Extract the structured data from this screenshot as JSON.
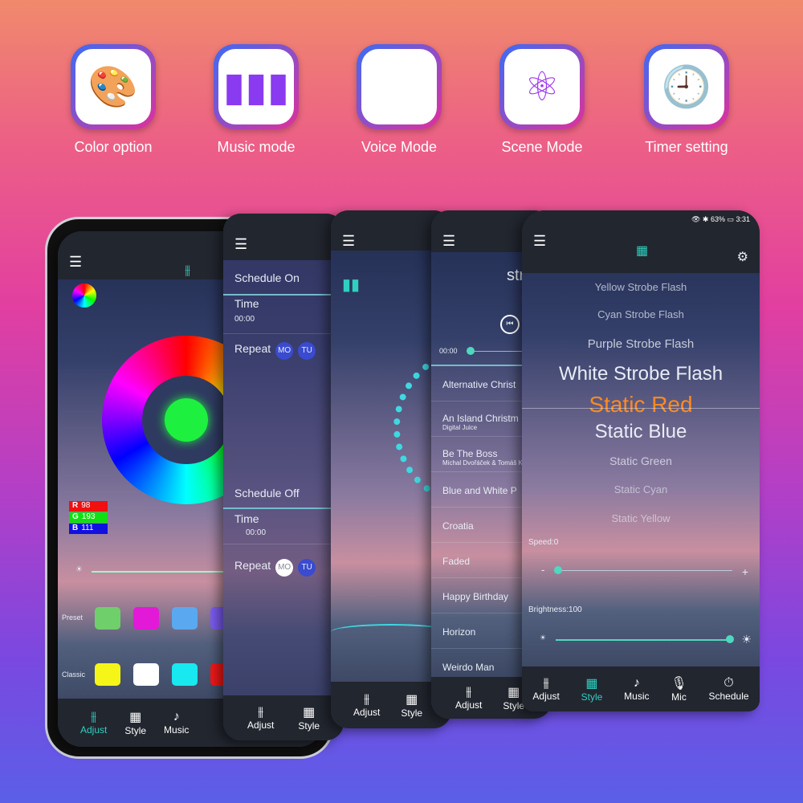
{
  "features": [
    {
      "label": "Color option",
      "icon": "palette-icon"
    },
    {
      "label": "Music mode",
      "icon": "soundwave-icon"
    },
    {
      "label": "Voice Mode",
      "icon": "microphone-icon"
    },
    {
      "label": "Scene Mode",
      "icon": "atom-icon"
    },
    {
      "label": "Timer setting",
      "icon": "clock-icon"
    }
  ],
  "status": {
    "battery": "63%",
    "time": "3:31"
  },
  "color_screen": {
    "rgb": {
      "r_label": "R",
      "r": "98",
      "g_label": "G",
      "g": "193",
      "b_label": "B",
      "b": "111"
    },
    "preset_label": "Preset",
    "classic_label": "Classic",
    "preset_colors": [
      "#6fcf6a",
      "#e21ad8",
      "#5aa8f0",
      "#7a5cf0"
    ],
    "classic_colors": [
      "#f5f518",
      "#ffffff",
      "#18e8f0",
      "#f01818"
    ]
  },
  "schedule_screen": {
    "on_label": "Schedule On",
    "time_label": "Time",
    "time_on": "00:00",
    "repeat_label": "Repeat",
    "days_on": [
      "MO",
      "TU"
    ],
    "off_label": "Schedule Off",
    "time_off": "00:00",
    "days_off": [
      "MO",
      "TU"
    ]
  },
  "songs_screen": {
    "title_partial": "str",
    "elapsed": "00:00",
    "songs": [
      {
        "title": "Alternative Christ",
        "artist": ""
      },
      {
        "title": "An Island Christm",
        "artist": "Digital Juice"
      },
      {
        "title": "Be The Boss",
        "artist": "Michal Dvořáček & Tomáš K"
      },
      {
        "title": "Blue and White P",
        "artist": ""
      },
      {
        "title": "Croatia",
        "artist": ""
      },
      {
        "title": "Faded",
        "artist": ""
      },
      {
        "title": "Happy Birthday",
        "artist": ""
      },
      {
        "title": "Horizon",
        "artist": ""
      },
      {
        "title": "Weirdo Man",
        "artist": ""
      }
    ]
  },
  "style_screen": {
    "modes": [
      "Yellow Strobe Flash",
      "Cyan Strobe Flash",
      "Purple Strobe Flash",
      "White Strobe Flash",
      "Static Red",
      "Static Blue",
      "Static Green",
      "Static Cyan",
      "Static Yellow"
    ],
    "selected": "Static Red",
    "speed_label": "Speed:0",
    "speed": 0,
    "brightness_label": "Brightness:100",
    "brightness": 100
  },
  "nav": {
    "adjust": "Adjust",
    "style": "Style",
    "music": "Music",
    "mic": "Mic",
    "schedule": "Schedule"
  },
  "colors": {
    "accent": "#2fd0c0",
    "selected_mode": "#ff8a1e"
  }
}
